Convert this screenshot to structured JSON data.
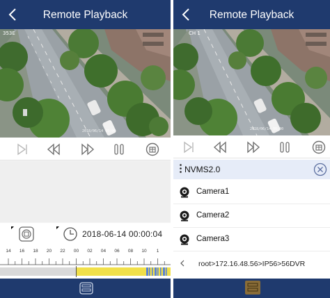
{
  "left_screen": {
    "title": "Remote Playback",
    "channel_label": "353E",
    "video_timestamp": "2018/06/14 00:00",
    "date_time": "2018-06-14 00:00:04",
    "timeline": {
      "hour_labels": [
        "14",
        "16",
        "18",
        "20",
        "22",
        "00",
        "02",
        "04",
        "06",
        "08",
        "10",
        "1"
      ],
      "recording_color": "#f1e04a",
      "marker_color": "#5a83d6"
    }
  },
  "right_screen": {
    "title": "Remote Playback",
    "channel_label": "CH 1",
    "video_timestamp": "2018/06/14 00:00",
    "device": {
      "name": "NVMS2.0"
    },
    "cameras": [
      {
        "name": "Camera1"
      },
      {
        "name": "Camera2"
      },
      {
        "name": "Camera3"
      }
    ],
    "path": "root>172.16.48.56>IP56>56DVR"
  },
  "icons": {
    "back": "back-arrow-icon",
    "frame_step": "frame-step-icon",
    "rewind": "rewind-icon",
    "fast_forward": "fast-forward-icon",
    "pause": "pause-icon",
    "snapshot": "snapshot-icon",
    "device_tree": "device-tree-icon",
    "clock": "clock-icon",
    "camera": "camera-icon",
    "close": "close-icon",
    "menu": "menu-dots-icon"
  },
  "colors": {
    "header": "#1f3a6e",
    "accent_light": "#e6ecf8",
    "icon_gray": "#7a7a7a"
  }
}
